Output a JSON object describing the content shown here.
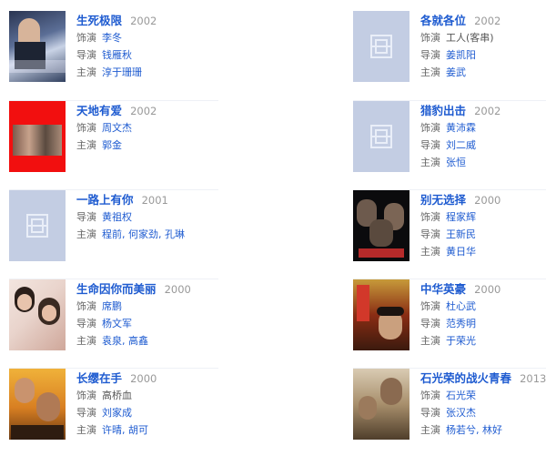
{
  "cards": [
    {
      "title": "生死极限",
      "year": "2002",
      "rows": [
        {
          "label": "饰演",
          "value": "李冬"
        },
        {
          "label": "导演",
          "value": "钱雁秋"
        },
        {
          "label": "主演",
          "value": "淳于珊珊"
        }
      ]
    },
    {
      "title": "各就各位",
      "year": "2002",
      "rows": [
        {
          "label": "饰演",
          "value": "工人(客串)"
        },
        {
          "label": "导演",
          "value": "姜凯阳"
        },
        {
          "label": "主演",
          "value": "姜武"
        }
      ]
    },
    {
      "title": "天地有爱",
      "year": "2002",
      "rows": [
        {
          "label": "饰演",
          "value": "周文杰"
        },
        {
          "label": "主演",
          "value": "郭金"
        }
      ]
    },
    {
      "title": "猎豹出击",
      "year": "2002",
      "rows": [
        {
          "label": "饰演",
          "value": "黄沛霖"
        },
        {
          "label": "导演",
          "value": "刘二威"
        },
        {
          "label": "主演",
          "value": "张恒"
        }
      ]
    },
    {
      "title": "一路上有你",
      "year": "2001",
      "rows": [
        {
          "label": "导演",
          "value": "黄祖权"
        },
        {
          "label": "主演",
          "value": "程前, 何家劲, 孔琳"
        }
      ]
    },
    {
      "title": "别无选择",
      "year": "2000",
      "rows": [
        {
          "label": "饰演",
          "value": "程家辉"
        },
        {
          "label": "导演",
          "value": "王新民"
        },
        {
          "label": "主演",
          "value": "黄日华"
        }
      ]
    },
    {
      "title": "生命因你而美丽",
      "year": "2000",
      "rows": [
        {
          "label": "饰演",
          "value": "席鹏"
        },
        {
          "label": "导演",
          "value": "杨文军"
        },
        {
          "label": "主演",
          "value": "袁泉, 高鑫"
        }
      ]
    },
    {
      "title": "中华英豪",
      "year": "2000",
      "rows": [
        {
          "label": "饰演",
          "value": "杜心武"
        },
        {
          "label": "导演",
          "value": "范秀明"
        },
        {
          "label": "主演",
          "value": "于荣光"
        }
      ]
    },
    {
      "title": "长缨在手",
      "year": "2000",
      "rows": [
        {
          "label": "饰演",
          "value": "高桥血"
        },
        {
          "label": "导演",
          "value": "刘家成"
        },
        {
          "label": "主演",
          "value": "许晴, 胡可"
        }
      ]
    },
    {
      "title": "石光荣的战火青春",
      "year": "2013",
      "rows": [
        {
          "label": "饰演",
          "value": "石光荣"
        },
        {
          "label": "导演",
          "value": "张汉杰"
        },
        {
          "label": "主演",
          "value": "杨若兮, 林好"
        }
      ]
    }
  ]
}
